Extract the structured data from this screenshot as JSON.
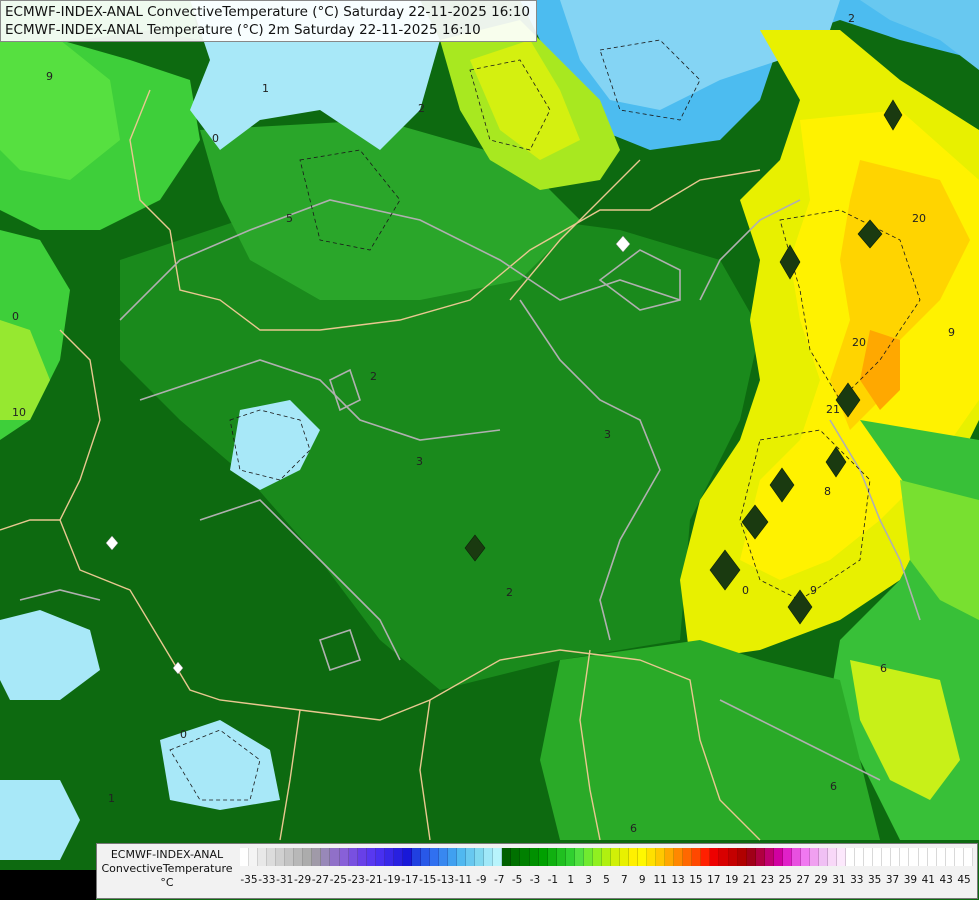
{
  "title": {
    "line1": "ECMWF-INDEX-ANAL ConvectiveTemperature (°C) Saturday 22-11-2025 16:10",
    "line2": "ECMWF-INDEX-ANAL Temperature (°C) 2m Saturday 22-11-2025 16:10"
  },
  "legend": {
    "line1": "ECMWF-INDEX-ANAL",
    "line2": "ConvectiveTemperature",
    "line3": "°C",
    "tick_labels": [
      "-35",
      "-33",
      "-31",
      "-29",
      "-27",
      "-25",
      "-23",
      "-21",
      "-19",
      "-17",
      "-15",
      "-13",
      "-11",
      "-9",
      "-7",
      "-5",
      "-3",
      "-1",
      "1",
      "3",
      "5",
      "7",
      "9",
      "11",
      "13",
      "15",
      "17",
      "19",
      "21",
      "23",
      "25",
      "27",
      "29",
      "31",
      "33",
      "35",
      "37",
      "39",
      "41",
      "43",
      "45"
    ],
    "colors": [
      "#ffffff",
      "#f4f4f4",
      "#e8e8e8",
      "#dcdcdc",
      "#d0d0d0",
      "#c4c4c4",
      "#b8b8b8",
      "#acacac",
      "#a09aa8",
      "#9888b8",
      "#9070c8",
      "#8860d8",
      "#7850e0",
      "#6840e8",
      "#5838f0",
      "#4830f0",
      "#3828e8",
      "#2820e0",
      "#1818d8",
      "#2040e0",
      "#2858e8",
      "#3070f0",
      "#3888f0",
      "#40a0f0",
      "#50b8f0",
      "#68c8f0",
      "#80d8f0",
      "#a0e8f8",
      "#b8f4fc",
      "#006000",
      "#007000",
      "#008000",
      "#009000",
      "#00a000",
      "#10b010",
      "#20c020",
      "#30d030",
      "#50e040",
      "#70ea30",
      "#90f020",
      "#b0f010",
      "#d0f008",
      "#e8f000",
      "#fff000",
      "#fff800",
      "#ffe000",
      "#ffc800",
      "#ffa800",
      "#ff8800",
      "#ff6800",
      "#ff4800",
      "#ff2000",
      "#ee0000",
      "#d80000",
      "#c40000",
      "#b00000",
      "#a00018",
      "#b00040",
      "#c00070",
      "#d000a0",
      "#e020c8",
      "#e850e0",
      "#f078f0",
      "#f0a0f0",
      "#f0c0f4",
      "#f8d8f8",
      "#fce8fc",
      "#ffffff",
      "#ffffff",
      "#ffffff",
      "#ffffff",
      "#ffffff",
      "#ffffff",
      "#ffffff",
      "#ffffff",
      "#ffffff",
      "#ffffff",
      "#ffffff",
      "#ffffff",
      "#ffffff",
      "#ffffff"
    ]
  },
  "map": {
    "background_color": "#1f7a1f",
    "accent_yellow": "#f2f200",
    "accent_cyan": "#a8e8f8"
  }
}
